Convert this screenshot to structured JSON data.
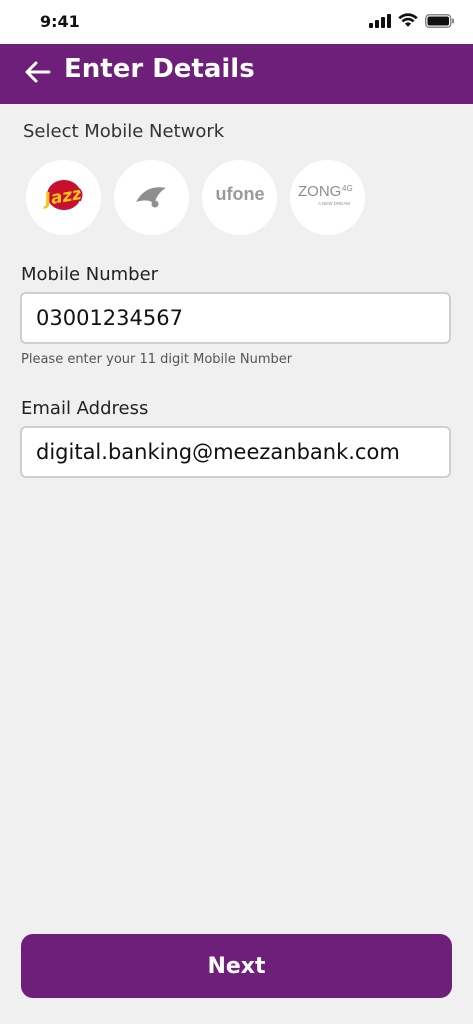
{
  "status_bar": {
    "time": "9:41"
  },
  "header": {
    "title": "Enter Details"
  },
  "network": {
    "label": "Select Mobile Network",
    "options": [
      {
        "name": "Jazz",
        "logo_text": "Jazz"
      },
      {
        "name": "Telenor",
        "logo_text": ""
      },
      {
        "name": "Ufone",
        "logo_text": "ufone"
      },
      {
        "name": "Zong",
        "logo_text": "ZONG",
        "logo_badge": "4G",
        "logo_tagline": "A NEW DREAM"
      }
    ]
  },
  "mobile": {
    "label": "Mobile Number",
    "value": "03001234567",
    "hint": "Please enter your 11 digit Mobile Number"
  },
  "email": {
    "label": "Email Address",
    "value": "digital.banking@meezanbank.com"
  },
  "footer": {
    "next_label": "Next"
  },
  "colors": {
    "primary": "#6d1f7a",
    "background": "#f0f0f0",
    "jazz_yellow": "#f5c518",
    "jazz_red": "#c8102e"
  }
}
